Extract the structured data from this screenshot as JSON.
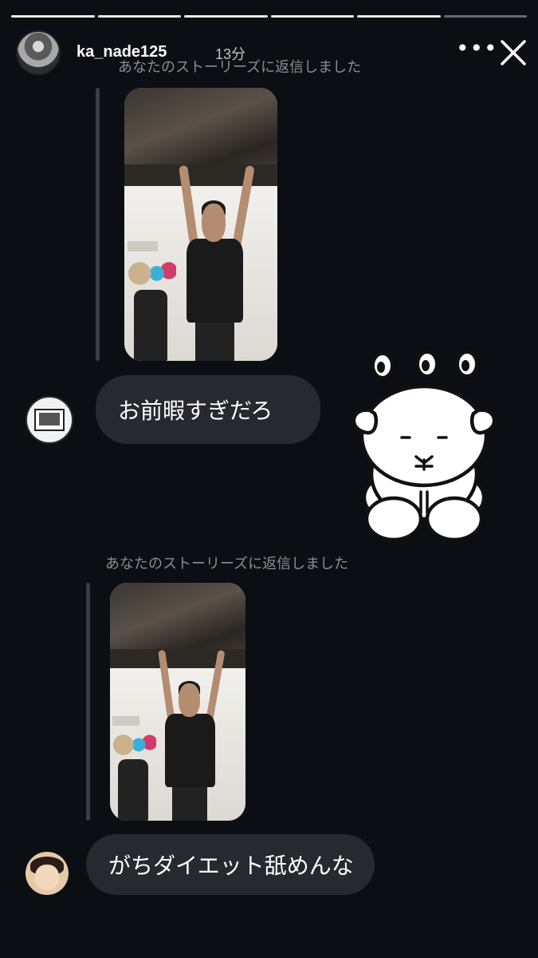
{
  "story": {
    "progress_segments": 6,
    "completed_segments": 5
  },
  "header": {
    "username": "ka_nade125",
    "time": "13分",
    "more_glyph": "•••",
    "close_icon": "close-icon",
    "avatar_icon": "profile-avatar"
  },
  "messages": [
    {
      "reply_note": "あなたのストーリーズに返信しました",
      "story_thumb_icon": "story-preview",
      "text": "お前暇すぎだろ",
      "sender_avatar": "sender-avatar-polaroid"
    },
    {
      "reply_note": "あなたのストーリーズに返信しました",
      "story_thumb_icon": "story-preview",
      "text": "がちダイエット舐めんな",
      "sender_avatar": "sender-avatar-child"
    }
  ],
  "sticker": {
    "icon": "dog-sticker",
    "color_outline": "#111111",
    "color_fill": "#ffffff"
  },
  "colors": {
    "background": "#0b0e13",
    "bubble": "#26292f",
    "reply_note": "#8a8d93"
  }
}
